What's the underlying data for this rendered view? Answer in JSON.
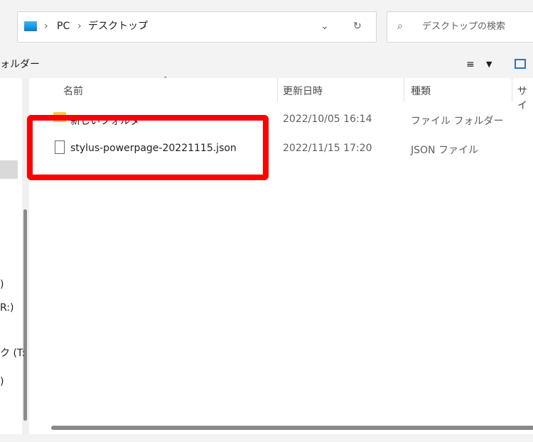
{
  "window": {
    "title": "デスクトップ"
  },
  "address": {
    "segments": [
      "PC",
      "デスクトップ"
    ],
    "icons": {
      "location": "desktop-icon",
      "chevron": "chevron-right-icon",
      "history": "chevron-down-icon",
      "refresh": "refresh-icon"
    }
  },
  "search": {
    "placeholder": "デスクトップの検索",
    "icon": "search-icon"
  },
  "toolbar": {
    "left_text": "ォルダー"
  },
  "nav_fragments": [
    ")",
    "R:)",
    "ク (T:",
    ")"
  ],
  "columns": [
    "名前",
    "更新日時",
    "種類",
    "サイ"
  ],
  "rows": [
    {
      "name": "新しいフォルダー",
      "modified": "2022/10/05 16:14",
      "type": "ファイル フォルダー",
      "icon": "folder-icon"
    },
    {
      "name": "stylus-powerpage-20221115.json",
      "modified": "2022/11/15 17:20",
      "type": "JSON ファイル",
      "icon": "file-icon"
    }
  ],
  "colors": {
    "highlight": "#ff0000",
    "chrome": "#f3f3f3",
    "folder": "#f2c94c"
  }
}
